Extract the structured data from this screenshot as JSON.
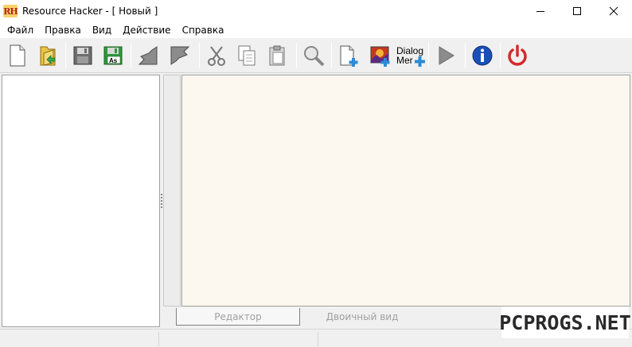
{
  "window": {
    "app_logo_text": "RH",
    "title": "Resource Hacker - [ Новый ]"
  },
  "menu": {
    "items": [
      "Файл",
      "Правка",
      "Вид",
      "Действие",
      "Справка"
    ]
  },
  "toolbar": {
    "dialog_menu_line1": "Dialog",
    "dialog_menu_line2": "Mer",
    "icons": [
      "new-file-icon",
      "open-file-icon",
      "save-icon",
      "save-as-icon",
      "import-icon",
      "export-icon",
      "cut-icon",
      "copy-icon",
      "paste-icon",
      "find-icon",
      "add-resource-icon",
      "add-image-icon",
      "add-dialog-menu-icon",
      "compile-run-icon",
      "info-icon",
      "exit-power-icon"
    ],
    "save_as_badge": "As"
  },
  "tabs": {
    "editor": "Редактор",
    "binary": "Двоичный вид",
    "active": "editor"
  },
  "watermark": "PCPROGS.NET",
  "colors": {
    "editor_bg": "#fdf8ef",
    "save_as_green": "#2e9a3a",
    "info_blue": "#1b4fb8",
    "power_red": "#d42a2a",
    "run_gray": "#8c8c8c"
  }
}
